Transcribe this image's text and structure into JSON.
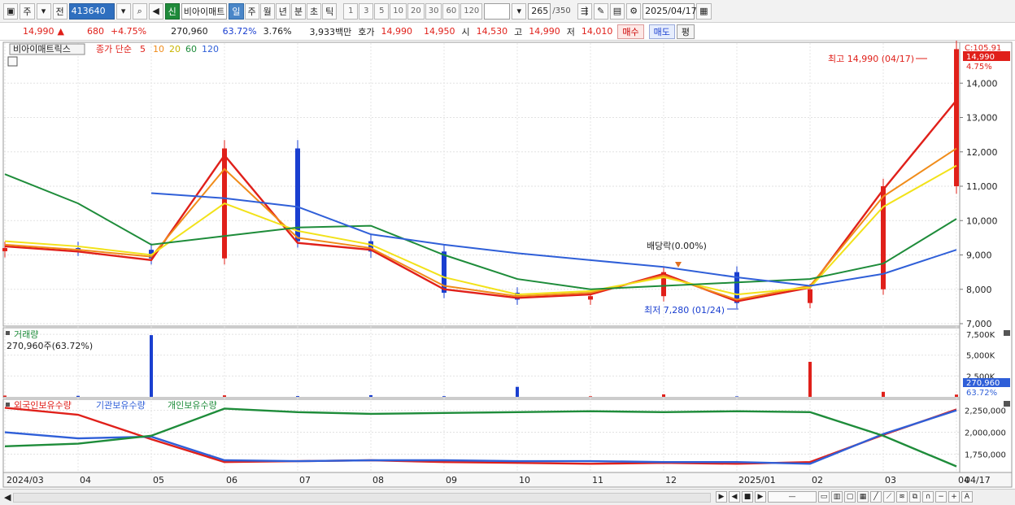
{
  "toolbar": {
    "type_select": "주",
    "compare_label": "전",
    "code": "413640",
    "stock_badge": "신",
    "stock_name": "비아이매트",
    "periods": [
      "일",
      "주",
      "월",
      "년",
      "분",
      "초",
      "틱"
    ],
    "active_period": "일",
    "intervals": [
      "1",
      "3",
      "5",
      "10",
      "20",
      "30",
      "60",
      "120"
    ],
    "count": "265",
    "count_total": "/350",
    "date": "2025/04/17"
  },
  "quote": {
    "price": "14,990",
    "change_arrow": "▲",
    "change": "680",
    "change_pct": "+4.75%",
    "volume": "270,960",
    "volume_ratio": "63.72%",
    "turnover_rate": "3.76%",
    "amount": "3,933백만",
    "bid_label": "호가",
    "bid1": "14,990",
    "bid2": "14,950",
    "open_label": "시",
    "open": "14,530",
    "high_label": "고",
    "high": "14,990",
    "low_label": "저",
    "low": "14,010",
    "buy_button": "매수",
    "sell_button": "매도",
    "eval_button": "평"
  },
  "legend": {
    "stock": "비아이매트릭스",
    "ma_prefix": "종가 단순",
    "ma_periods": [
      "5",
      "10",
      "20",
      "60",
      "120"
    ],
    "volume_title": "거래량",
    "volume_value": "270,960주(63.72%)",
    "holdings": [
      "외국인보유수량",
      "기관보유수량",
      "개인보유수량"
    ]
  },
  "annotations": {
    "high": "최고 14,990 (04/17)",
    "low": "최저 7,280 (01/24)",
    "dividend": "배당락(0.00%)"
  },
  "price_axis": {
    "ticks": [
      "14,000",
      "13,000",
      "12,000",
      "11,000",
      "10,000",
      "9,000",
      "8,000",
      "7,000"
    ],
    "current_tag": "14,990",
    "pct_tag": "4.75%",
    "top_label": "C:105.91"
  },
  "volume_axis": {
    "ticks": [
      "7,500K",
      "5,000K",
      "2,500K"
    ],
    "current_tag": "270,960",
    "pct_tag": "63.72%"
  },
  "holdings_axis": {
    "ticks": [
      "2,250,000",
      "2,000,000",
      "1,750,000"
    ]
  },
  "x_axis": {
    "labels": [
      "2024/03",
      "04",
      "05",
      "06",
      "07",
      "08",
      "09",
      "10",
      "11",
      "12",
      "2025/01",
      "02",
      "03",
      "04"
    ],
    "end_label": "04/17"
  },
  "colors": {
    "up": "#e0201a",
    "down": "#1a3fd0",
    "ma5": "#e0201a",
    "ma10": "#f08c1a",
    "ma20": "#f2e21a",
    "ma60": "#1e8c3a",
    "ma120": "#2f5fd8",
    "foreign": "#e0201a",
    "institution": "#2f5fd8",
    "individual": "#1e8c3a"
  },
  "chart_data": [
    {
      "type": "candlestick",
      "title": "비아이매트릭스",
      "ylim": [
        7000,
        15000
      ],
      "x": [
        "2024/03",
        "04",
        "05",
        "06",
        "07",
        "08",
        "09",
        "10",
        "11",
        "12",
        "2025/01",
        "02",
        "03",
        "04"
      ],
      "series": [
        {
          "name": "종가",
          "values": [
            9200,
            9150,
            8900,
            12100,
            9400,
            9100,
            7900,
            7700,
            7800,
            8500,
            7600,
            8000,
            11000,
            14990
          ]
        },
        {
          "name": "5",
          "values": [
            9250,
            9100,
            8850,
            11900,
            9350,
            9150,
            8000,
            7750,
            7850,
            8450,
            7650,
            8050,
            10900,
            13500
          ]
        },
        {
          "name": "10",
          "values": [
            9300,
            9150,
            8950,
            11500,
            9500,
            9200,
            8100,
            7800,
            7900,
            8400,
            7700,
            8100,
            10700,
            12100
          ]
        },
        {
          "name": "20",
          "values": [
            9400,
            9250,
            9000,
            10500,
            9700,
            9300,
            8350,
            7850,
            7950,
            8350,
            7850,
            8050,
            10400,
            11600
          ]
        },
        {
          "name": "60",
          "values": [
            11350,
            10500,
            9300,
            9550,
            9800,
            9850,
            9000,
            8300,
            8000,
            8100,
            8200,
            8300,
            8750,
            10050
          ]
        },
        {
          "name": "120",
          "values": [
            null,
            null,
            10800,
            10650,
            10400,
            9600,
            9300,
            9050,
            8850,
            8650,
            8350,
            8100,
            8450,
            9150
          ]
        }
      ],
      "annotations": [
        "최고 14,990 (04/17)",
        "최저 7,280 (01/24)",
        "배당락(0.00%)"
      ]
    },
    {
      "type": "bar",
      "title": "거래량",
      "ylim": [
        0,
        7800000
      ],
      "categories": [
        "2024/03",
        "04",
        "05",
        "06",
        "07",
        "08",
        "09",
        "10",
        "11",
        "12",
        "2025/01",
        "02",
        "03",
        "04"
      ],
      "values": [
        150000,
        120000,
        7400000,
        180000,
        90000,
        200000,
        80000,
        1200000,
        70000,
        300000,
        60000,
        4200000,
        600000,
        270960
      ]
    },
    {
      "type": "line",
      "title": "보유수량",
      "ylim": [
        1550000,
        2330000
      ],
      "x": [
        "2024/03",
        "04",
        "05",
        "06",
        "07",
        "08",
        "09",
        "10",
        "11",
        "12",
        "2025/01",
        "02",
        "03",
        "04"
      ],
      "series": [
        {
          "name": "외국인보유수량",
          "values": [
            2280000,
            2200000,
            1920000,
            1660000,
            1670000,
            1680000,
            1660000,
            1650000,
            1640000,
            1650000,
            1640000,
            1660000,
            1970000,
            2260000
          ]
        },
        {
          "name": "기관보유수량",
          "values": [
            2000000,
            1930000,
            1950000,
            1680000,
            1670000,
            1680000,
            1680000,
            1670000,
            1670000,
            1660000,
            1660000,
            1640000,
            1980000,
            2250000
          ]
        },
        {
          "name": "개인보유수량",
          "values": [
            1840000,
            1870000,
            1960000,
            2270000,
            2230000,
            2210000,
            2220000,
            2230000,
            2240000,
            2230000,
            2240000,
            2230000,
            1960000,
            1610000
          ]
        }
      ]
    }
  ]
}
